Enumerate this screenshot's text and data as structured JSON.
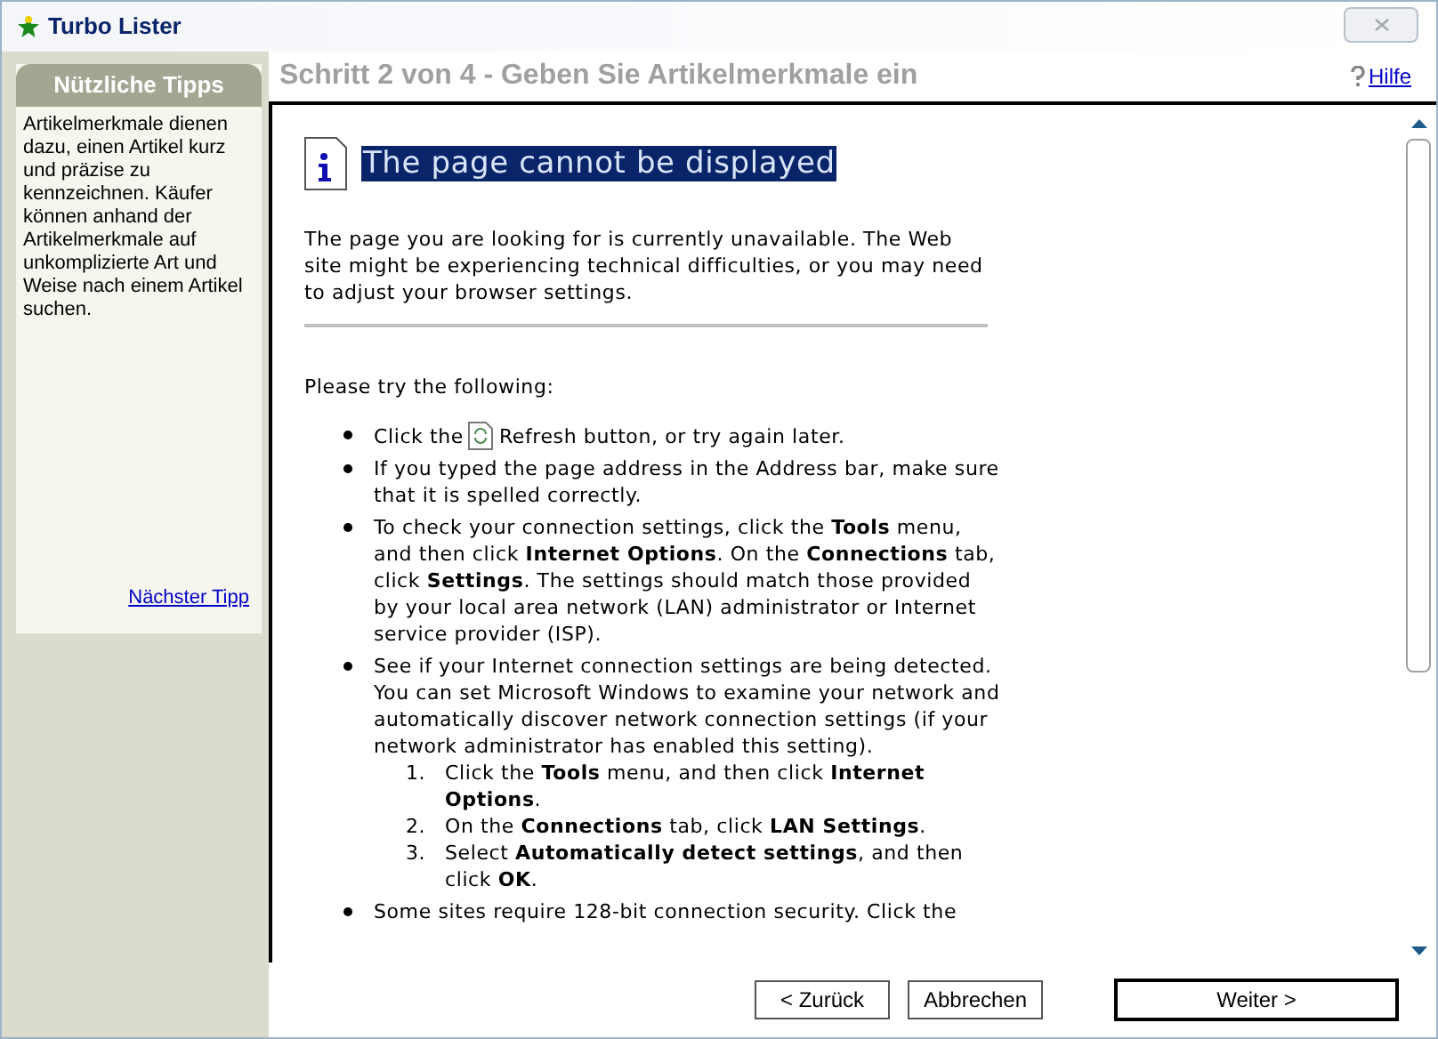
{
  "window": {
    "title": "Turbo Lister"
  },
  "sidebar": {
    "title": "Nützliche Tipps",
    "tip": "Artikelmerkmale dienen dazu, einen Artikel kurz und präzise zu kennzeichnen. Käufer können anhand der Artikelmerkmale auf unkomplizierte Art und Weise nach einem Artikel suchen.",
    "next_link": "Nächster Tipp"
  },
  "header": {
    "title": "Schritt 2 von 4 - Geben Sie Artikelmerkmale ein",
    "help_link": "Hilfe"
  },
  "page": {
    "heading": "The page cannot be displayed",
    "intro": "The page you are looking for is currently unavailable. The Web site might be experiencing technical difficulties, or you may need to adjust your browser settings.",
    "try_label": "Please try the following:",
    "items": [
      {
        "kind": "refresh",
        "before": "Click the",
        "after": "Refresh button, or try again later."
      },
      {
        "kind": "text",
        "text": "If you typed the page address in the Address bar, make sure that it is spelled correctly."
      },
      {
        "kind": "text",
        "text": "To check your connection settings, click the **Tools** menu, and then click **Internet Options**. On the **Connections** tab, click **Settings**. The settings should match those provided by your local area network (LAN) administrator or Internet service provider (ISP)."
      },
      {
        "kind": "text",
        "text": "See if your Internet connection settings are being detected. You can set Microsoft Windows to examine your network and automatically discover network connection settings (if your network administrator has enabled this setting).",
        "steps": [
          {
            "number": "1.",
            "text": "Click the **Tools** menu, and then click **Internet Options**."
          },
          {
            "number": "2.",
            "text": "On the **Connections** tab, click **LAN Settings**."
          },
          {
            "number": "3.",
            "text": "Select **Automatically detect settings**, and then click **OK**."
          }
        ]
      },
      {
        "kind": "text",
        "text": "Some sites require 128-bit connection security. Click the"
      }
    ]
  },
  "buttons": [
    {
      "label": "< Zurück",
      "default": false
    },
    {
      "label": "Abbrechen",
      "default": false
    },
    {
      "label": "Weiter >",
      "default": true
    }
  ]
}
